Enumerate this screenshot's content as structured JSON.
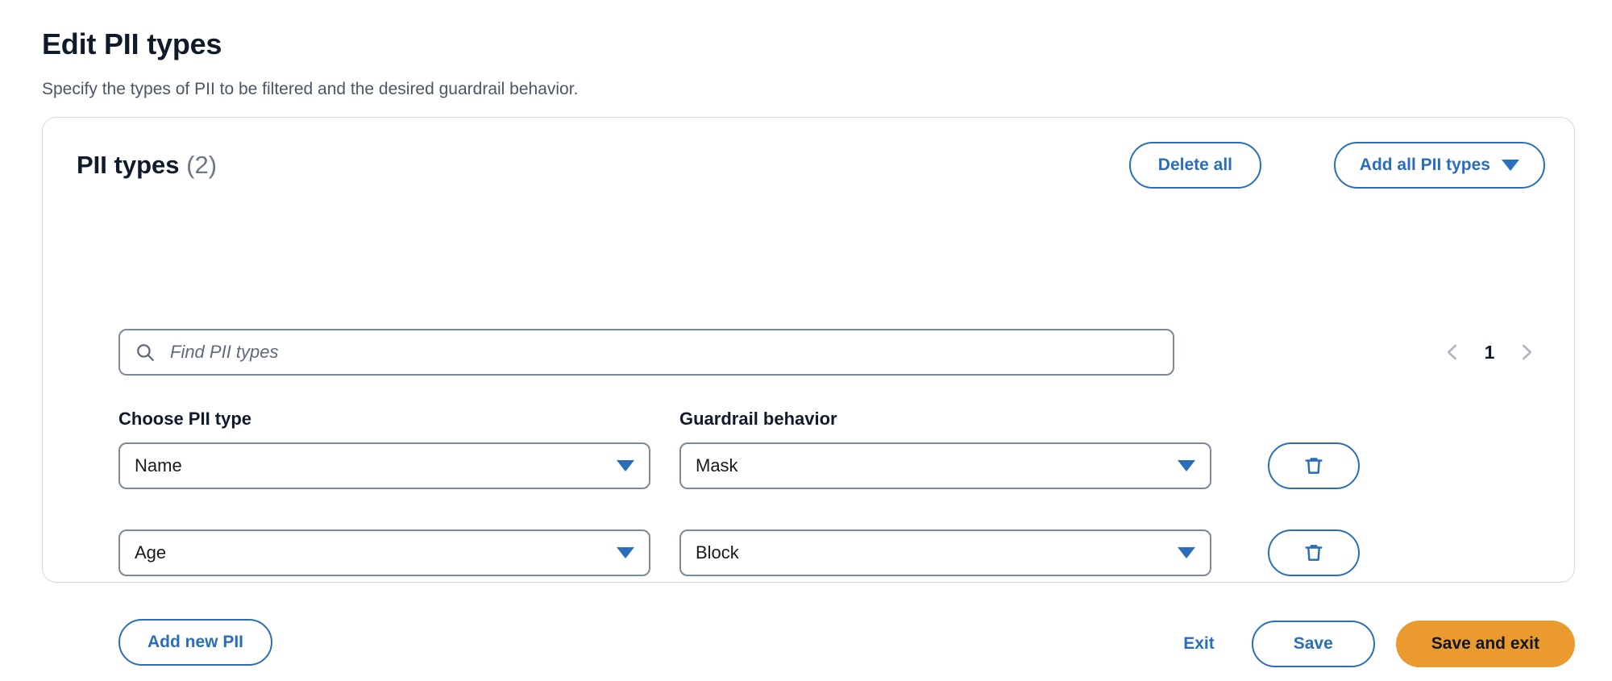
{
  "page": {
    "title": "Edit PII types",
    "subtitle": "Specify the types of PII to be filtered and the desired guardrail behavior."
  },
  "card": {
    "title": "PII types",
    "count": "(2)",
    "header_actions": {
      "delete_all_label": "Delete all",
      "add_all_label": "Add all PII types",
      "add_all_caret_icon": "chevron-down-icon"
    },
    "search": {
      "placeholder": "Find PII types",
      "value": "",
      "icon": "search-icon"
    },
    "pagination": {
      "prev_icon": "chevron-left-icon",
      "next_icon": "chevron-right-icon",
      "current_page": "1"
    },
    "columns": {
      "pii_type_label": "Choose PII type",
      "guardrail_behavior_label": "Guardrail behavior"
    },
    "rows": [
      {
        "pii_type": "Name",
        "guardrail_behavior": "Mask",
        "delete_icon": "trash-icon"
      },
      {
        "pii_type": "Age",
        "guardrail_behavior": "Block",
        "delete_icon": "trash-icon"
      }
    ],
    "add_new_label": "Add new PII"
  },
  "footer": {
    "exit_label": "Exit",
    "save_label": "Save",
    "save_and_exit_label": "Save and exit"
  },
  "colors": {
    "accent_blue": "#2a6ebb",
    "primary_orange": "#eb9b2e",
    "text_dark": "#0f1b2a",
    "text_muted": "#4a5664",
    "border_gray": "#7d8998",
    "card_border": "#d4d8dd"
  }
}
